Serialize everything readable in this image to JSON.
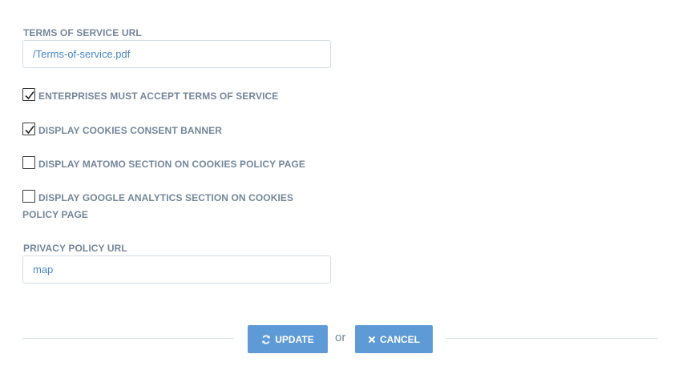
{
  "terms": {
    "label": "TERMS OF SERVICE URL",
    "value": "/Terms-of-service.pdf"
  },
  "checkboxes": [
    {
      "label": "ENTERPRISES MUST ACCEPT TERMS OF SERVICE",
      "checked": true
    },
    {
      "label": "DISPLAY COOKIES CONSENT BANNER",
      "checked": true
    },
    {
      "label": "DISPLAY MATOMO SECTION ON COOKIES POLICY PAGE",
      "checked": false
    },
    {
      "label": "DISPLAY GOOGLE ANALYTICS SECTION ON COOKIES POLICY PAGE",
      "checked": false
    }
  ],
  "privacy": {
    "label": "PRIVACY POLICY URL",
    "value": "map"
  },
  "actions": {
    "update_label": "UPDATE",
    "update_icon": "refresh-icon",
    "or_text": "or",
    "cancel_label": "CANCEL",
    "cancel_icon": "close-icon"
  },
  "colors": {
    "label": "#74879a",
    "input_text": "#4a87c9",
    "button": "#5e9bd6"
  }
}
